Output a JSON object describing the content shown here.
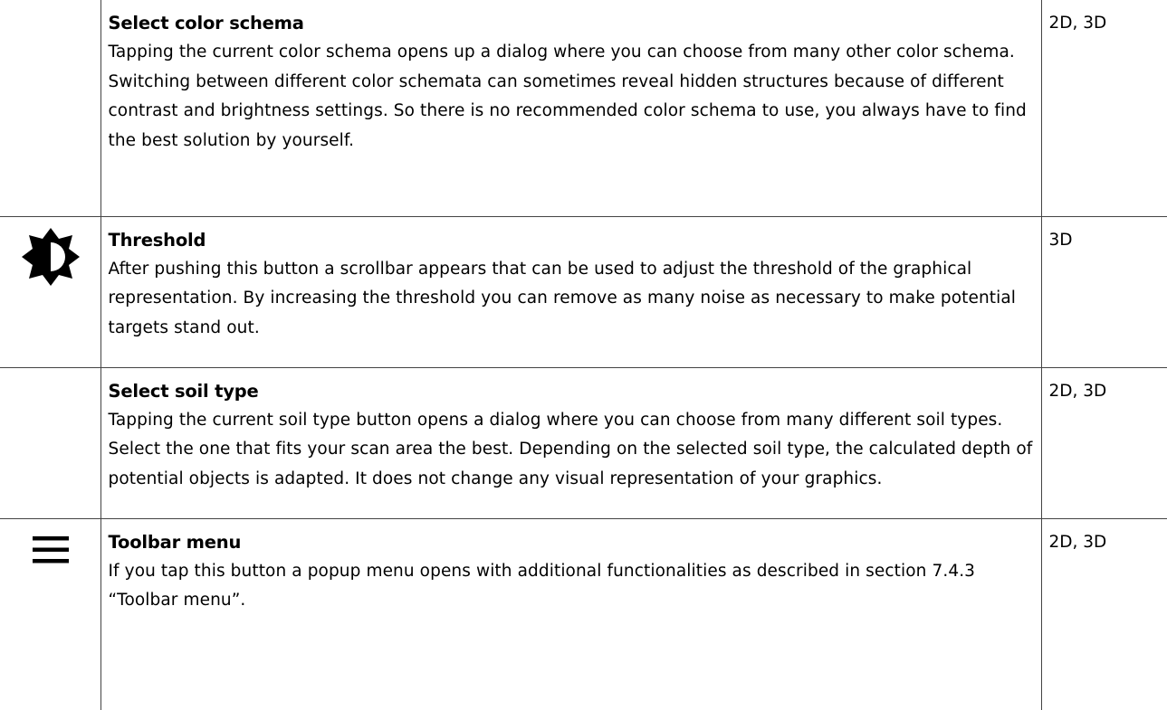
{
  "rows": [
    {
      "icon": "",
      "title": "Select color schema",
      "description": "Tapping the current color schema opens up a dialog where you can choose from many other color schema. Switching between different color schemata can sometimes reveal hidden structures because of different contrast and brightness settings. So there is no recommended color schema to use, you always have to find the best solution by yourself.",
      "modes": "2D, 3D"
    },
    {
      "icon": "brightness-contrast-icon",
      "title": "Threshold",
      "description": "After pushing this button a scrollbar appears that can be used to adjust the threshold of the graphical representation. By increasing the threshold you can remove as many noise as necessary to make potential targets stand out.",
      "modes": "3D"
    },
    {
      "icon": "",
      "title": "Select soil type",
      "description": "Tapping the current soil type button opens a dialog where you can choose from many different soil types. Select the one that fits your scan area the best. Depending on the selected soil type, the calculated depth of potential objects is adapted. It does not change any visual representation of your graphics.",
      "modes": "2D, 3D"
    },
    {
      "icon": "hamburger-menu-icon",
      "title": "Toolbar menu",
      "description": "If you tap this button a popup menu opens with additional functionalities as described in section 7.4.3 “Toolbar menu”.",
      "modes": "2D, 3D"
    }
  ]
}
